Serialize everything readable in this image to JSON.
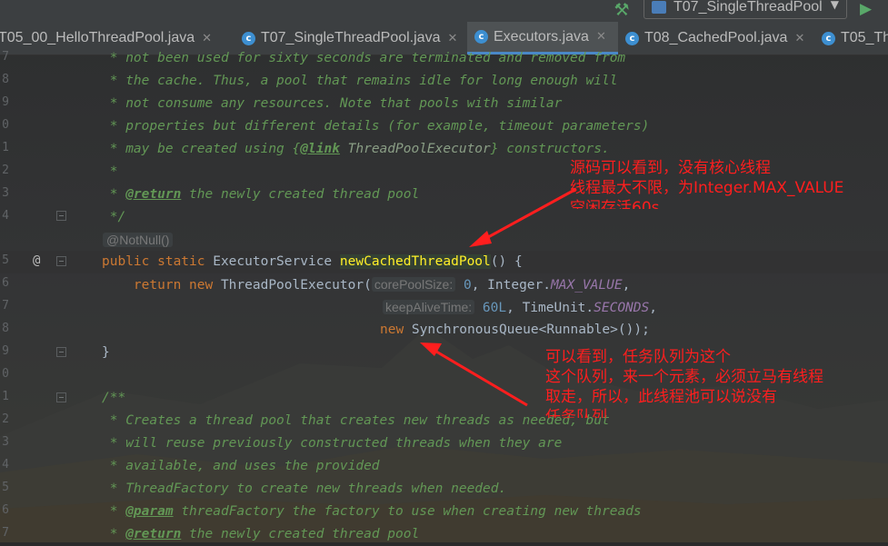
{
  "toolbar": {
    "run_config": "T07_SingleThreadPool"
  },
  "tabs": [
    {
      "label": "T05_00_HelloThreadPool.java",
      "active": false
    },
    {
      "label": "T07_SingleThreadPool.java",
      "active": false
    },
    {
      "label": "Executors.java",
      "active": true
    },
    {
      "label": "T08_CachedPool.java",
      "active": false
    },
    {
      "label": "T05_Th",
      "active": false
    }
  ],
  "gutter": {
    "line_numbers": [
      "7",
      "8",
      "9",
      "0",
      "1",
      "2",
      "3",
      "4",
      "",
      "5",
      "6",
      "7",
      "8",
      "9",
      "0",
      "1",
      "2",
      "3",
      "4",
      "5",
      "6",
      "7"
    ],
    "override_marker": "@"
  },
  "code": {
    "l1": " * not been used for sixty seconds are terminated and removed from",
    "l2": " * the cache. Thus, a pool that remains idle for long enough will",
    "l3": " * not consume any resources. Note that pools with similar",
    "l4": " * properties but different details (for example, timeout parameters)",
    "l5a": " * may be created using {",
    "l5b": "@link",
    "l5c": " ThreadPoolExecutor",
    "l5d": "} constructors.",
    "l6": " *",
    "l7a": " * ",
    "l7b": "@return",
    "l7c": " the newly created thread pool",
    "l8": " */",
    "annotation": "@NotNull()",
    "l10a": "public static ",
    "l10b": "ExecutorService ",
    "l10c": "newCachedThreadPool",
    "l10d": "() {",
    "l11a": "    return new ",
    "l11b": "ThreadPoolExecutor(",
    "hint_core": "corePoolSize:",
    "l11c": " 0",
    "l11d": ", Integer.",
    "l11e": "MAX_VALUE",
    "l11f": ",",
    "hint_keep": "keepAliveTime:",
    "l12a": " 60L",
    "l12b": ", TimeUnit.",
    "l12c": "SECONDS",
    "l12d": ",",
    "l13a": "new ",
    "l13b": "SynchronousQueue<Runnable>());",
    "l14": "}",
    "l16": "/**",
    "l17": " * Creates a thread pool that creates new threads as needed, but",
    "l18": " * will reuse previously constructed threads when they are",
    "l19": " * available, and uses the provided",
    "l20": " * ThreadFactory to create new threads when needed.",
    "l21a": " * ",
    "l21b": "@param",
    "l21c": " threadFactory the factory to use when creating new threads",
    "l22a": " * ",
    "l22b": "@return",
    "l22c": " the newly created thread pool"
  },
  "notes": {
    "top": [
      "源码可以看到，没有核心线程",
      "线程最大不限，为Integer.MAX_VALUE",
      "空闲存活60s"
    ],
    "bottom": [
      "可以看到，任务队列为这个",
      "这个队列，来一个元素，必须立马有线程",
      "取走，所以，此线程池可以说没有",
      "任务队列"
    ]
  },
  "colors": {
    "background": "#2b2b2b",
    "comment": "#629755",
    "keyword": "#cc7832",
    "number": "#6897bb",
    "constant": "#9876aa",
    "annotation_red": "#ff1e1e",
    "tab_active_underline": "#4a88c7"
  },
  "icons": {
    "hammer": "build-hammer-icon",
    "run": "run-triangle-icon",
    "java_class": "java-class-c-icon",
    "close": "close-x-icon",
    "fold": "fold-marker-icon"
  }
}
